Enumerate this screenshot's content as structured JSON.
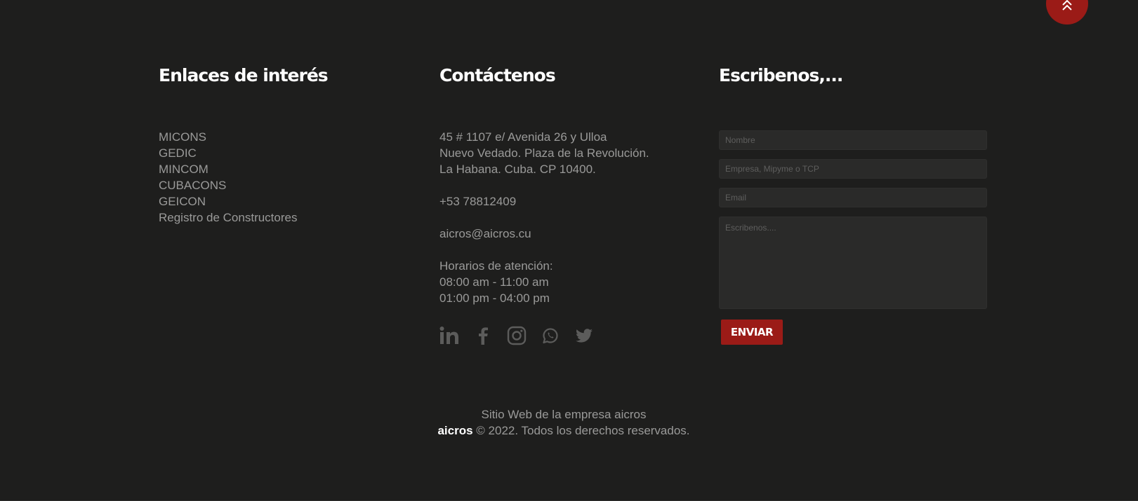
{
  "scroll_top": {
    "icon": "double-chevron-up-icon",
    "color": "#9b1b17"
  },
  "links": {
    "title": "Enlaces de interés",
    "items": [
      {
        "label": "MICONS"
      },
      {
        "label": "GEDIC"
      },
      {
        "label": "MINCOM"
      },
      {
        "label": "CUBACONS"
      },
      {
        "label": "GEICON"
      },
      {
        "label": "Registro de Constructores"
      }
    ]
  },
  "contact": {
    "title": "Contáctenos",
    "address": [
      "45 # 1107 e/ Avenida 26 y Ulloa",
      "Nuevo Vedado. Plaza de la Revolución.",
      "La Habana. Cuba. CP 10400."
    ],
    "phone": "+53 78812409",
    "email": "aicros@aicros.cu",
    "hours_label": "Horarios de atención:",
    "hours": [
      "08:00 am - 11:00 am",
      "01:00 pm - 04:00 pm"
    ],
    "social": [
      {
        "icon": "linkedin-icon"
      },
      {
        "icon": "facebook-icon"
      },
      {
        "icon": "instagram-icon"
      },
      {
        "icon": "whatsapp-icon"
      },
      {
        "icon": "twitter-icon"
      }
    ]
  },
  "form": {
    "title": "Escribenos,...",
    "name_placeholder": "Nombre",
    "company_placeholder": "Empresa, Mipyme o TCP",
    "email_placeholder": "Email",
    "message_placeholder": "Escribenos....",
    "submit_label": "ENVIAR"
  },
  "footer": {
    "line1": "Sitio Web de la empresa aicros",
    "brand": "aicros",
    "copyright": "© 2022. Todos los derechos reservados."
  },
  "colors": {
    "background": "#1e1e1d",
    "accent": "#9b1b17",
    "text_muted": "#9a9a99",
    "heading": "#ffffff"
  }
}
